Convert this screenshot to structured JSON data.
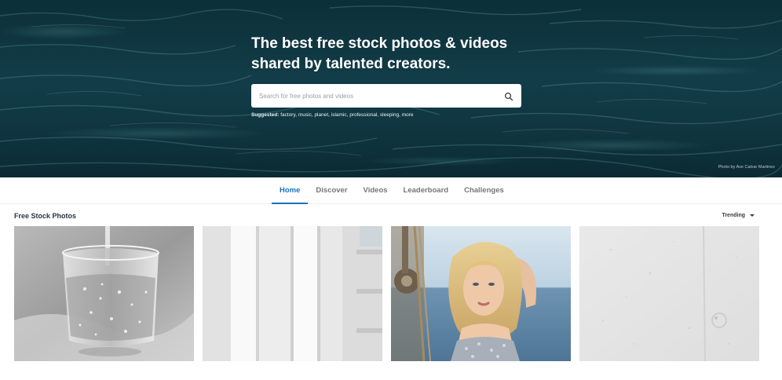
{
  "hero": {
    "title": "The best free stock photos & videos shared by talented creators.",
    "search_placeholder": "Search for free photos and videos",
    "suggested_label": "Suggested:",
    "suggested_terms": "factory, music, planet, islamic, professional, sleeping, more",
    "photo_credit": "Photo by Ave Calvar Martinez"
  },
  "nav": {
    "tabs": [
      {
        "label": "Home",
        "active": true
      },
      {
        "label": "Discover"
      },
      {
        "label": "Videos"
      },
      {
        "label": "Leaderboard"
      },
      {
        "label": "Challenges"
      }
    ]
  },
  "main": {
    "section_title": "Free Stock Photos",
    "sort_label": "Trending"
  },
  "photos": [
    {
      "subject": "glass of water being poured"
    },
    {
      "subject": "white wooden panels"
    },
    {
      "subject": "blonde woman at sea by ship rigging"
    },
    {
      "subject": "white textured wall"
    }
  ],
  "colors": {
    "accent": "#1a73bb",
    "hero_water": "#123d48"
  }
}
